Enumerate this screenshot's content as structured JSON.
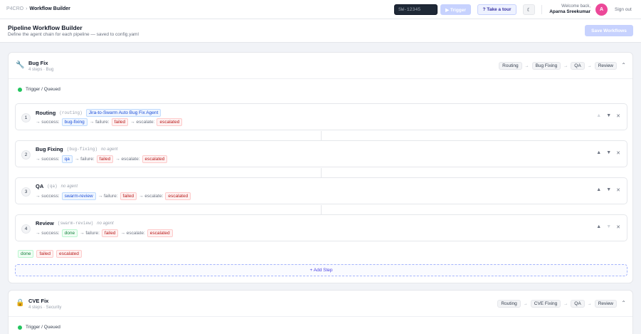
{
  "topbar": {
    "brand": "P4CRO",
    "separator": "›",
    "page": "Workflow Builder",
    "ticket_placeholder": "SW-12345",
    "trigger_label": "▶ Trigger",
    "tour_label": "? Take a tour",
    "theme_icon": "☾",
    "welcome": "Welcome back,",
    "user_name": "Aparna Sreekumar",
    "avatar_initial": "A",
    "signout_label": "Sign out"
  },
  "header": {
    "title": "Pipeline Workflow Builder",
    "subtitle": "Define the agent chain for each pipeline — saved to config.yaml",
    "save_label": "Save Workflows"
  },
  "pipelines": [
    {
      "icon": "🔧",
      "name": "Bug Fix",
      "meta": "4 steps · Bug",
      "chain": [
        "Routing",
        "Bug Fixing",
        "QA",
        "Review"
      ],
      "trigger_label": "Trigger / Queued",
      "steps": [
        {
          "num": "1",
          "name": "Routing",
          "key": "(routing)",
          "agent": "Jira-to-Swarm Auto Bug Fix Agent",
          "success_label": "→ success:",
          "success": "bug-fixing",
          "failure_label": "→ failure:",
          "failure": "failed",
          "escalate_label": "→ escalate:",
          "escalate": "escalated"
        },
        {
          "num": "2",
          "name": "Bug Fixing",
          "key": "(bug-fixing)",
          "agent": "no agent",
          "success_label": "→ success:",
          "success": "qa",
          "failure_label": "→ failure:",
          "failure": "failed",
          "escalate_label": "→ escalate:",
          "escalate": "escalated"
        },
        {
          "num": "3",
          "name": "QA",
          "key": "(qa)",
          "agent": "no agent",
          "success_label": "→ success:",
          "success": "swarm-review",
          "failure_label": "→ failure:",
          "failure": "failed",
          "escalate_label": "→ escalate:",
          "escalate": "escalated"
        },
        {
          "num": "4",
          "name": "Review",
          "key": "(swarm-review)",
          "agent": "no agent",
          "success_label": "→ success:",
          "success": "done",
          "failure_label": "→ failure:",
          "failure": "failed",
          "escalate_label": "→ escalate:",
          "escalate": "escalated"
        }
      ],
      "terminals": [
        "done",
        "failed",
        "escalated"
      ],
      "add_step_label": "+ Add Step"
    },
    {
      "icon": "🔒",
      "name": "CVE Fix",
      "meta": "4 steps · Security",
      "chain": [
        "Routing",
        "CVE Fixing",
        "QA",
        "Review"
      ],
      "trigger_label": "Trigger / Queued"
    }
  ],
  "icons": {
    "up": "▲",
    "down": "▼",
    "remove": "✕",
    "collapse": "⌃",
    "chain_arrow": "→"
  },
  "colors": {
    "accent": "#4f46e5",
    "success_dot": "#22c55e",
    "avatar": "#ec4899"
  }
}
